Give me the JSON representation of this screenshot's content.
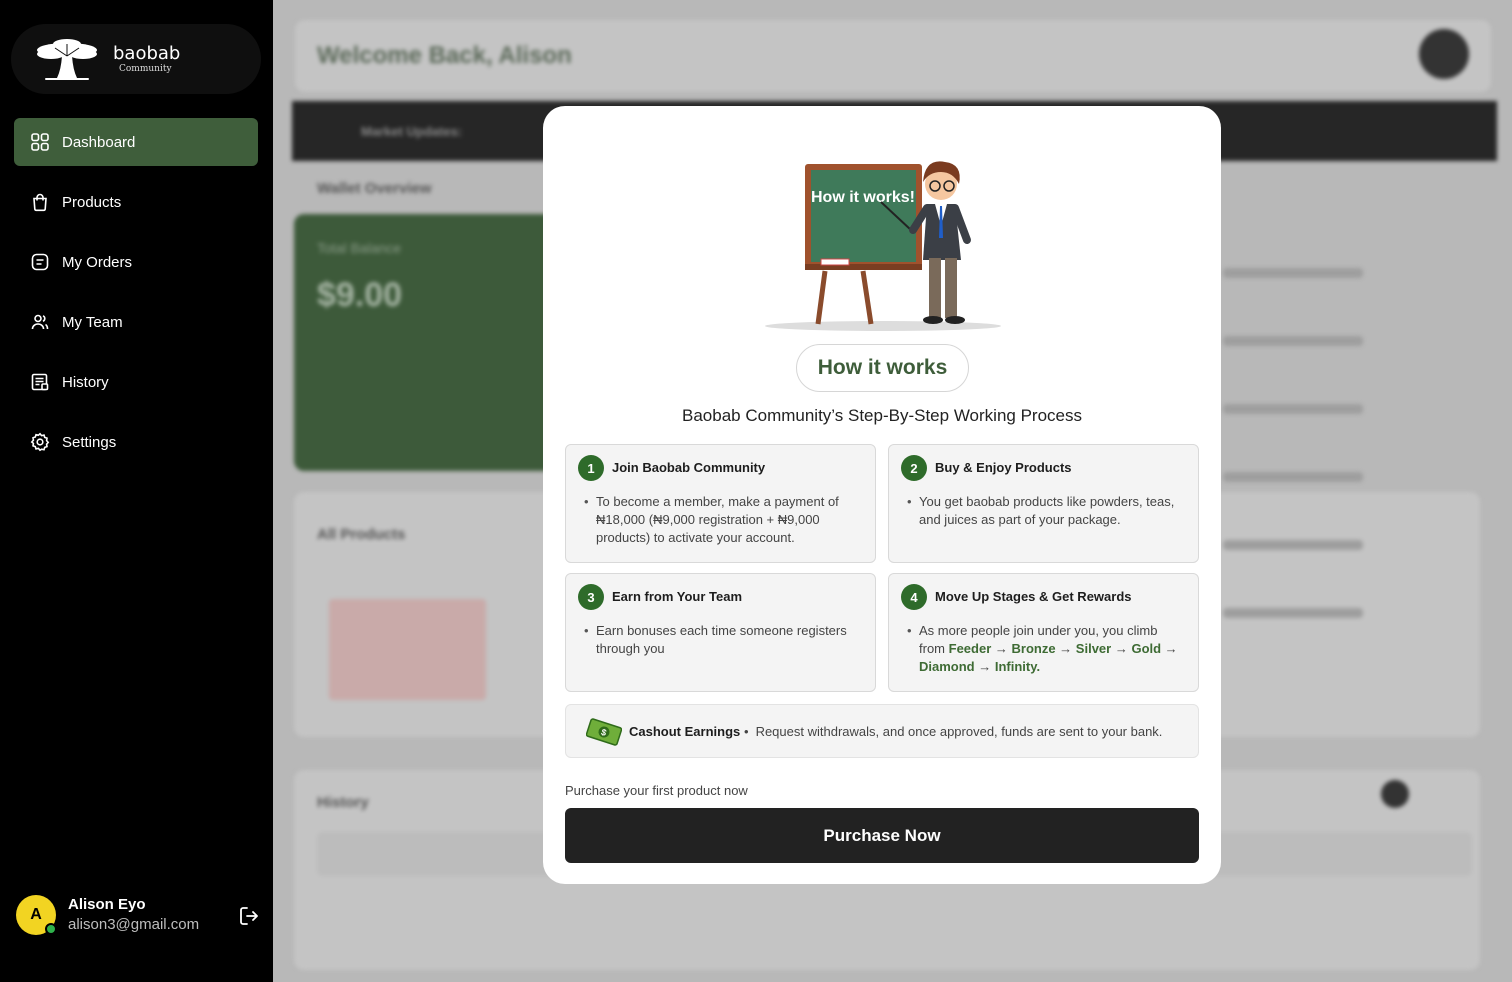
{
  "brand": {
    "name": "baobab",
    "sub": "Community"
  },
  "sidebar": {
    "items": [
      {
        "label": "Dashboard",
        "icon": "grid-icon",
        "active": true
      },
      {
        "label": "Products",
        "icon": "shopping-bag-icon",
        "active": false
      },
      {
        "label": "My Orders",
        "icon": "orders-icon",
        "active": false
      },
      {
        "label": "My Team",
        "icon": "team-icon",
        "active": false
      },
      {
        "label": "History",
        "icon": "history-icon",
        "active": false
      },
      {
        "label": "Settings",
        "icon": "gear-icon",
        "active": false
      }
    ],
    "user": {
      "initial": "A",
      "name": "Alison Eyo",
      "email": "alison3@gmail.com"
    }
  },
  "background": {
    "welcome": "Welcome Back, Alison",
    "market_label": "Market Updates:",
    "wallet_title": "Wallet Overview",
    "total_label": "Total Balance",
    "total_amount": "$9.00",
    "all_products": "All Products",
    "history": "History"
  },
  "modal": {
    "illustration_text": "How it works!",
    "pill": "How it works",
    "subtitle": "Baobab Community’s Step-By-Step Working Process",
    "steps": [
      {
        "num": "1",
        "title": "Join Baobab Community",
        "text": "To become a member, make a payment of ₦18,000 (₦9,000 registration + ₦9,000 products) to activate your account."
      },
      {
        "num": "2",
        "title": "Buy & Enjoy Products",
        "text": "You get baobab products like powders, teas, and juices as part of your package."
      },
      {
        "num": "3",
        "title": "Earn from Your Team",
        "text": "Earn bonuses each time someone registers through you"
      },
      {
        "num": "4",
        "title": "Move Up Stages & Get Rewards",
        "text_prefix": "As more people join under you, you climb from",
        "stages": [
          "Feeder",
          "Bronze",
          "Silver",
          "Gold",
          "Diamond",
          "Infinity."
        ]
      }
    ],
    "cashout": {
      "title": "Cashout Earnings",
      "text": "Request withdrawals, and once approved, funds are sent to your bank."
    },
    "purchase_hint": "Purchase your first product now",
    "purchase_button": "Purchase Now"
  }
}
